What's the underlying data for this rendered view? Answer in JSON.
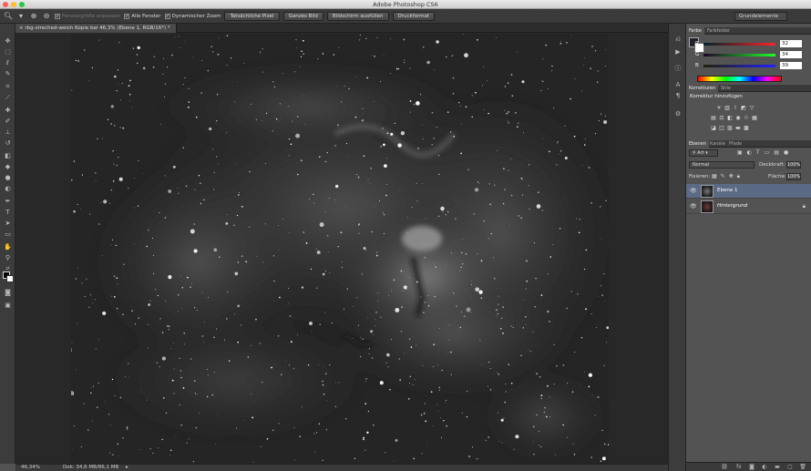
{
  "window": {
    "title": "Adobe Photoshop CS6"
  },
  "options": {
    "fit_window": "Fenstergröße anpassen",
    "all_windows": "Alle Fenster",
    "scrubby_zoom": "Dynamischer Zoom",
    "btn_actual": "Tatsächliche Pixel",
    "btn_fit": "Ganzes Bild",
    "btn_fill": "Bildschirm ausfüllen",
    "btn_print": "Druckformat",
    "workspace": "Grundelemente"
  },
  "document": {
    "tab_title": "rbg-streched-weich Kopie bei 46,3% (Ebene 1, RGB/16*) *"
  },
  "status": {
    "zoom": "46,34%",
    "doc": "Dok: 34,6 MB/86,1 MB"
  },
  "color_panel": {
    "tab_color": "Farbe",
    "tab_swatches": "Farbfelder",
    "foreground": "#20222a",
    "r_label": "R",
    "r_value": "32",
    "g_label": "G",
    "g_value": "34",
    "b_label": "B",
    "b_value": "39"
  },
  "adjustments": {
    "tab_adj": "Korrekturen",
    "tab_styles": "Stile",
    "title": "Korrektur hinzufügen"
  },
  "layers_panel": {
    "tab_layers": "Ebenen",
    "tab_channels": "Kanäle",
    "tab_paths": "Pfade",
    "filter": "Art",
    "blend_mode": "Normal",
    "opacity_label": "Deckkraft:",
    "opacity_value": "100%",
    "lock_label": "Fixieren:",
    "fill_label": "Fläche:",
    "fill_value": "100%",
    "layers": [
      {
        "name": "Ebene 1"
      },
      {
        "name": "Hintergrund"
      }
    ]
  }
}
